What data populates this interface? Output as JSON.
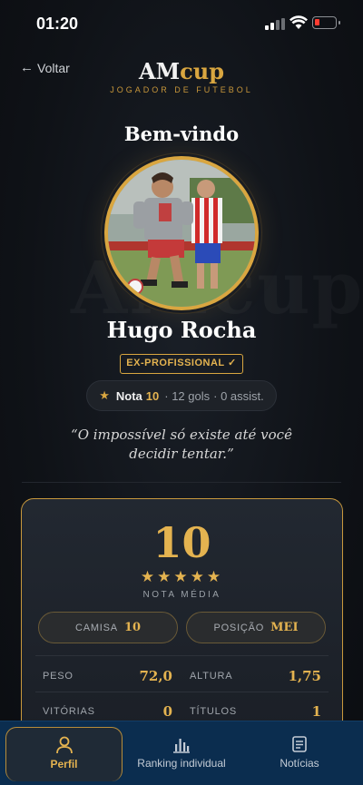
{
  "status_bar": {
    "time": "01:20"
  },
  "header": {
    "back_label": "Voltar",
    "brand_am": "AM",
    "brand_cup": "cup",
    "subtitle": "JOGADOR DE FUTEBOL"
  },
  "welcome": "Bem-vindo",
  "watermark": "AMcup",
  "profile": {
    "name": "Hugo Rocha",
    "badge": "EX-PROFISSIONAL ✓",
    "nota_label": "Nota",
    "nota_value": "10",
    "goals": "· 12 gols",
    "assists": "· 0 assist.",
    "quote": "“O impossível só existe até você decidir tentar.”"
  },
  "card": {
    "average": "10",
    "stars": "★★★★★",
    "average_label": "NOTA MÉDIA",
    "camisa_label": "CAMISA",
    "camisa_value": "10",
    "posicao_label": "POSIÇÃO",
    "posicao_value": "MEI",
    "stats": [
      {
        "label": "PESO",
        "value": "72,0"
      },
      {
        "label": "ALTURA",
        "value": "1,75"
      },
      {
        "label": "VITÓRIAS",
        "value": "0"
      },
      {
        "label": "TÍTULOS",
        "value": "1"
      }
    ]
  },
  "tabs": [
    {
      "label": "Perfil",
      "icon": "person-icon",
      "active": true
    },
    {
      "label": "Ranking individual",
      "icon": "bar-chart-icon",
      "active": false
    },
    {
      "label": "Notícias",
      "icon": "news-icon",
      "active": false
    }
  ],
  "colors": {
    "accent_gold": "#d9a640",
    "background": "#0e1116",
    "tabbar": "#0b2d4f"
  }
}
